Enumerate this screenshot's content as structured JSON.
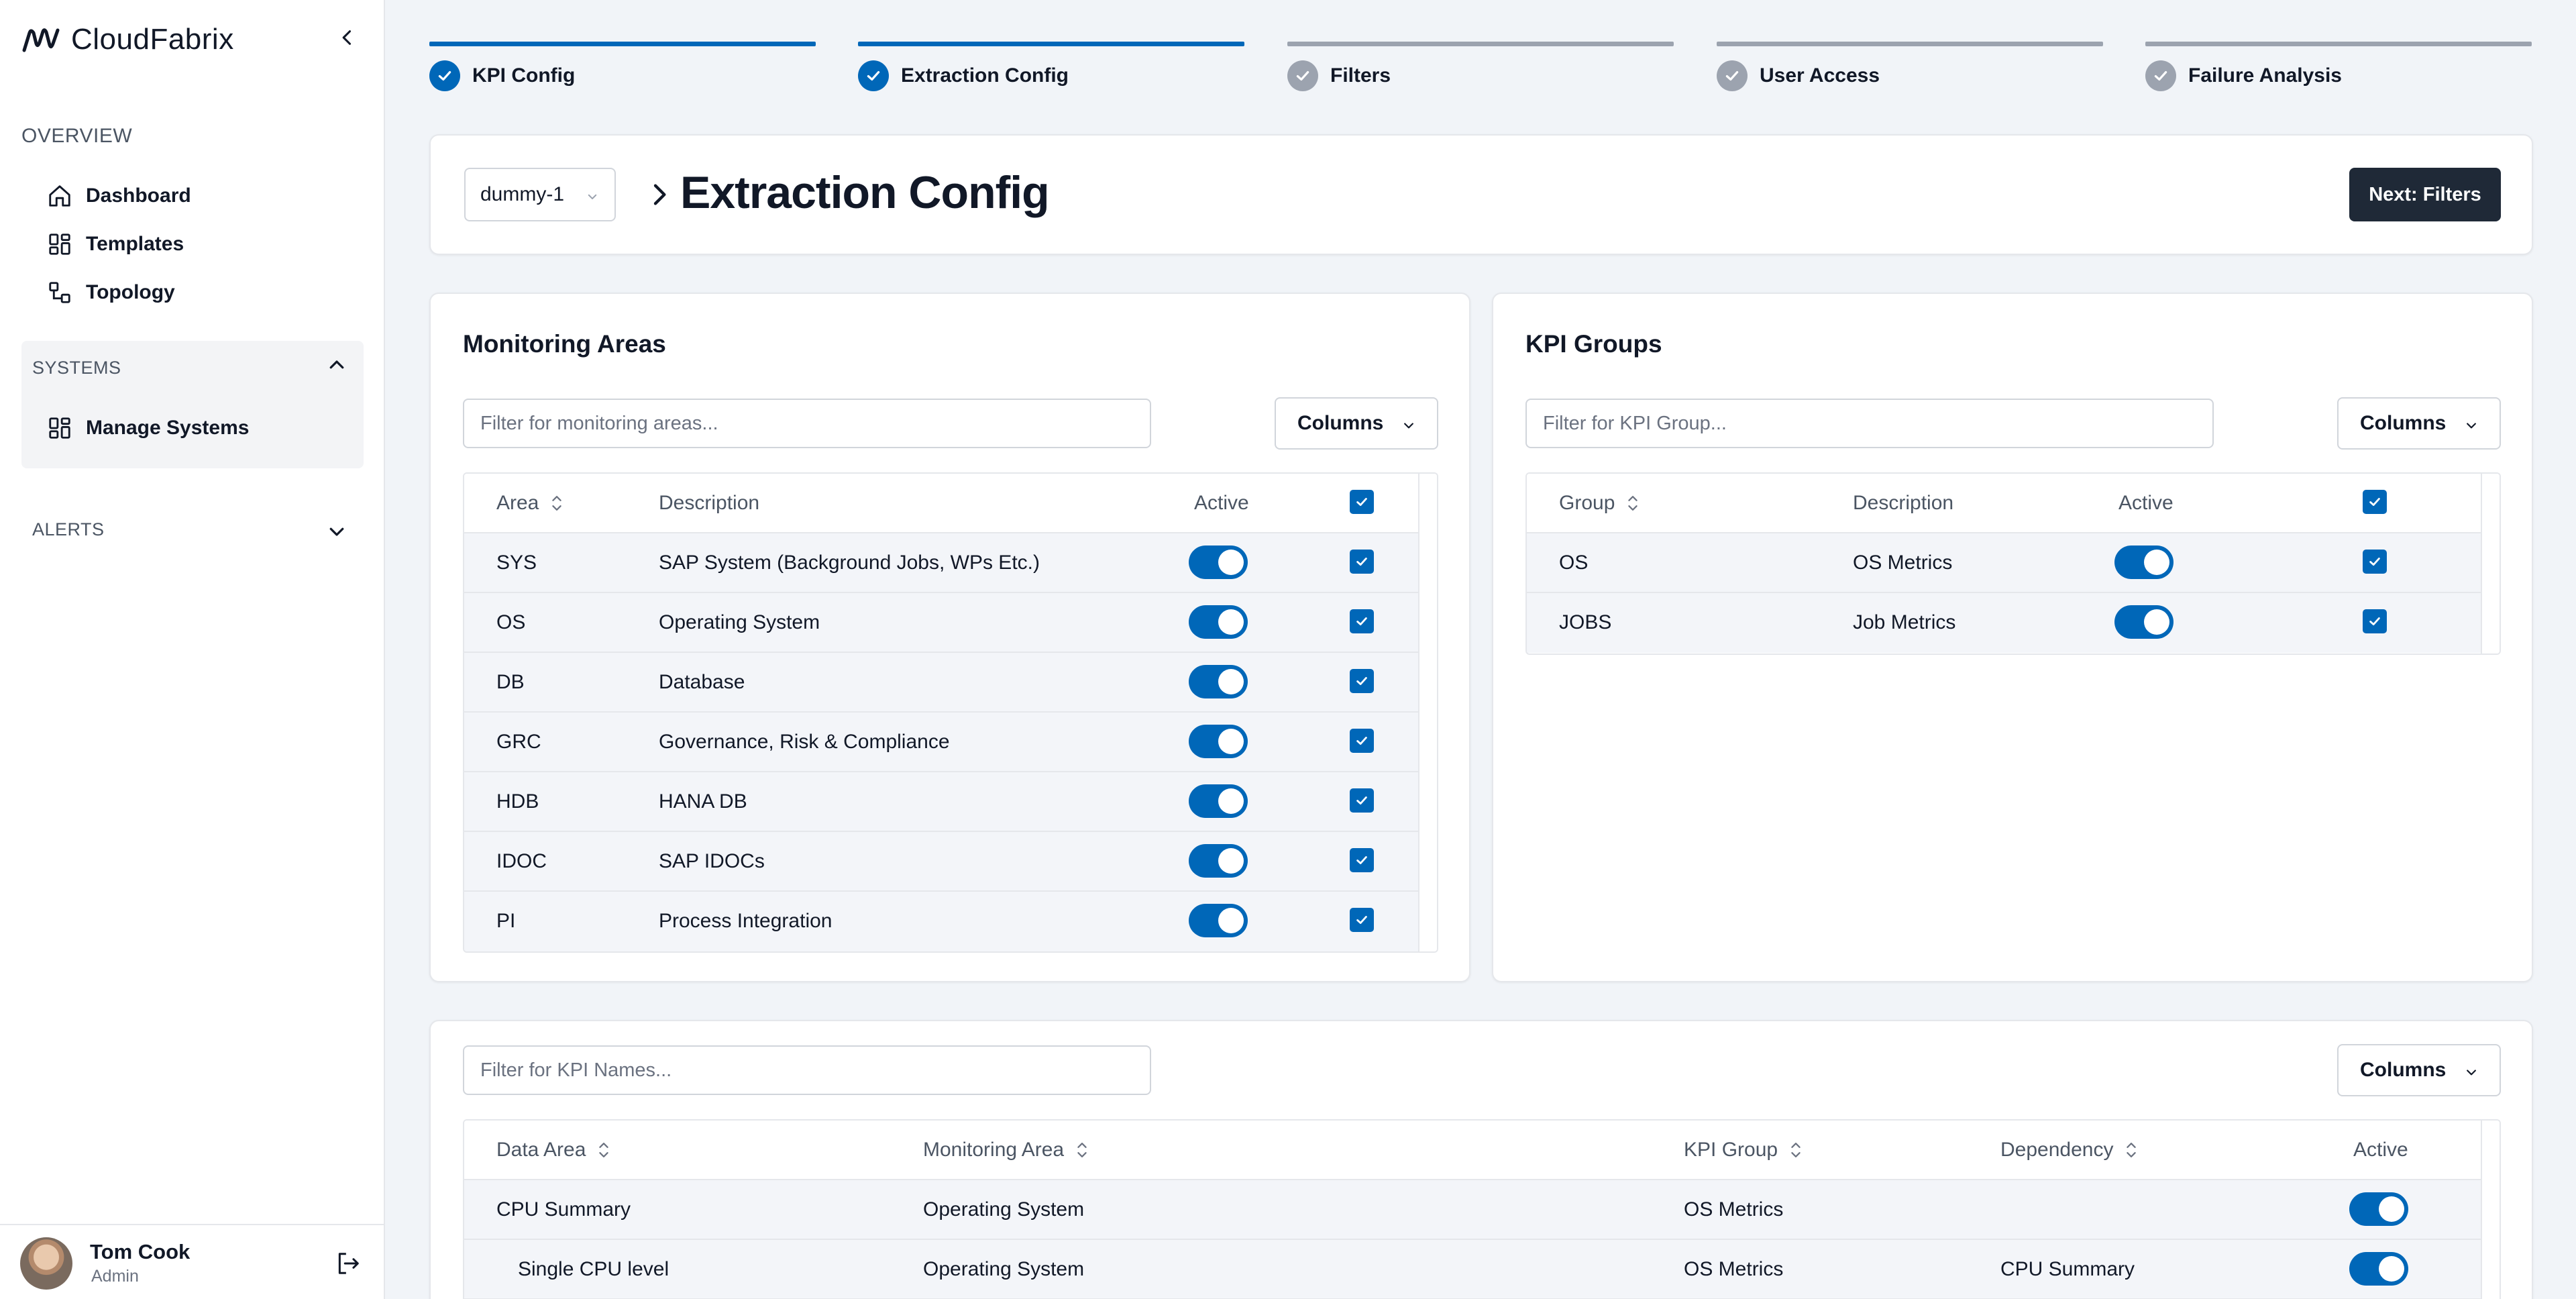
{
  "app": {
    "name": "CloudFabrix"
  },
  "sidebar": {
    "overview_title": "OVERVIEW",
    "overview_items": [
      {
        "label": "Dashboard",
        "icon": "home-icon"
      },
      {
        "label": "Templates",
        "icon": "grid-icon"
      },
      {
        "label": "Topology",
        "icon": "topology-icon"
      }
    ],
    "systems_title": "SYSTEMS",
    "systems_items": [
      {
        "label": "Manage Systems",
        "icon": "grid-icon"
      }
    ],
    "alerts_title": "ALERTS"
  },
  "user": {
    "name": "Tom Cook",
    "role": "Admin"
  },
  "steps": [
    {
      "label": "KPI Config",
      "done": true
    },
    {
      "label": "Extraction Config",
      "done": true
    },
    {
      "label": "Filters",
      "done": false
    },
    {
      "label": "User Access",
      "done": false
    },
    {
      "label": "Failure Analysis",
      "done": false
    }
  ],
  "header": {
    "system_select": "dummy-1",
    "title": "Extraction Config",
    "next_button": "Next: Filters"
  },
  "monitoring": {
    "title": "Monitoring Areas",
    "filter_placeholder": "Filter for monitoring areas...",
    "columns_label": "Columns",
    "headers": {
      "area": "Area",
      "description": "Description",
      "active": "Active"
    },
    "rows": [
      {
        "area": "SYS",
        "description": "SAP System (Background Jobs, WPs Etc.)"
      },
      {
        "area": "OS",
        "description": "Operating System"
      },
      {
        "area": "DB",
        "description": "Database"
      },
      {
        "area": "GRC",
        "description": "Governance, Risk & Compliance"
      },
      {
        "area": "HDB",
        "description": "HANA DB"
      },
      {
        "area": "IDOC",
        "description": "SAP IDOCs"
      },
      {
        "area": "PI",
        "description": "Process Integration"
      }
    ]
  },
  "kpi_groups": {
    "title": "KPI Groups",
    "filter_placeholder": "Filter for KPI Group...",
    "columns_label": "Columns",
    "headers": {
      "group": "Group",
      "description": "Description",
      "active": "Active"
    },
    "rows": [
      {
        "group": "OS",
        "description": "OS Metrics"
      },
      {
        "group": "JOBS",
        "description": "Job Metrics"
      }
    ]
  },
  "kpi_names": {
    "filter_placeholder": "Filter for KPI Names...",
    "columns_label": "Columns",
    "headers": {
      "data_area": "Data Area",
      "monitoring_area": "Monitoring Area",
      "kpi_group": "KPI Group",
      "dependency": "Dependency",
      "active": "Active"
    },
    "rows": [
      {
        "data_area": "CPU Summary",
        "monitoring_area": "Operating System",
        "kpi_group": "OS Metrics",
        "dependency": ""
      },
      {
        "data_area": "Single CPU level",
        "monitoring_area": "Operating System",
        "kpi_group": "OS Metrics",
        "dependency": "CPU Summary"
      }
    ]
  },
  "colors": {
    "accent": "#0067b8",
    "dark_button": "#1f2937",
    "background": "#f1f4f8"
  }
}
